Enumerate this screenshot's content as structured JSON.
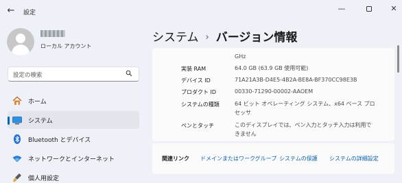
{
  "window": {
    "title": "設定",
    "back_glyph": "←",
    "minimize_glyph": "—",
    "close_glyph": "✕"
  },
  "profile": {
    "account_type": "ローカル アカウント"
  },
  "search": {
    "placeholder": "設定の検索"
  },
  "sidebar": {
    "items": [
      {
        "label": "ホーム",
        "icon": "home-icon",
        "active": false
      },
      {
        "label": "システム",
        "icon": "display-icon",
        "active": true
      },
      {
        "label": "Bluetooth とデバイス",
        "icon": "bluetooth-icon",
        "active": false
      },
      {
        "label": "ネットワークとインターネット",
        "icon": "wifi-icon",
        "active": false
      },
      {
        "label": "個人用設定",
        "icon": "brush-icon",
        "active": false
      }
    ]
  },
  "header": {
    "parent": "システム",
    "separator": "›",
    "current": "バージョン情報"
  },
  "specs": {
    "top_fragment": "GHz",
    "rows": [
      {
        "label": "実装 RAM",
        "value": "64.0 GB (63.9 GB 使用可能)"
      },
      {
        "label": "デバイス ID",
        "value": "71A21A3B-D4E5-4B2A-BE8A-BF370CC98E3B"
      },
      {
        "label": "プロダクト ID",
        "value": "00330-71290-00002-AAOEM"
      },
      {
        "label": "システムの種類",
        "value_line1": "64 ビット オペレーティング システム、x64 ベース プロ",
        "value_line2": "セッサ"
      },
      {
        "label": "ペンとタッチ",
        "value_line1": "このディスプレイでは、ペン入力とタッチ入力は利用で",
        "value_line2": "きません"
      }
    ]
  },
  "related": {
    "title": "関連リンク",
    "links": [
      "ドメインまたはワークグループ",
      "システムの保護",
      "システムの詳細設定"
    ]
  },
  "colors": {
    "accent": "#0067c0",
    "link": "#0a5fae",
    "background": "#eef2f8",
    "card": "#fbfbfc"
  }
}
